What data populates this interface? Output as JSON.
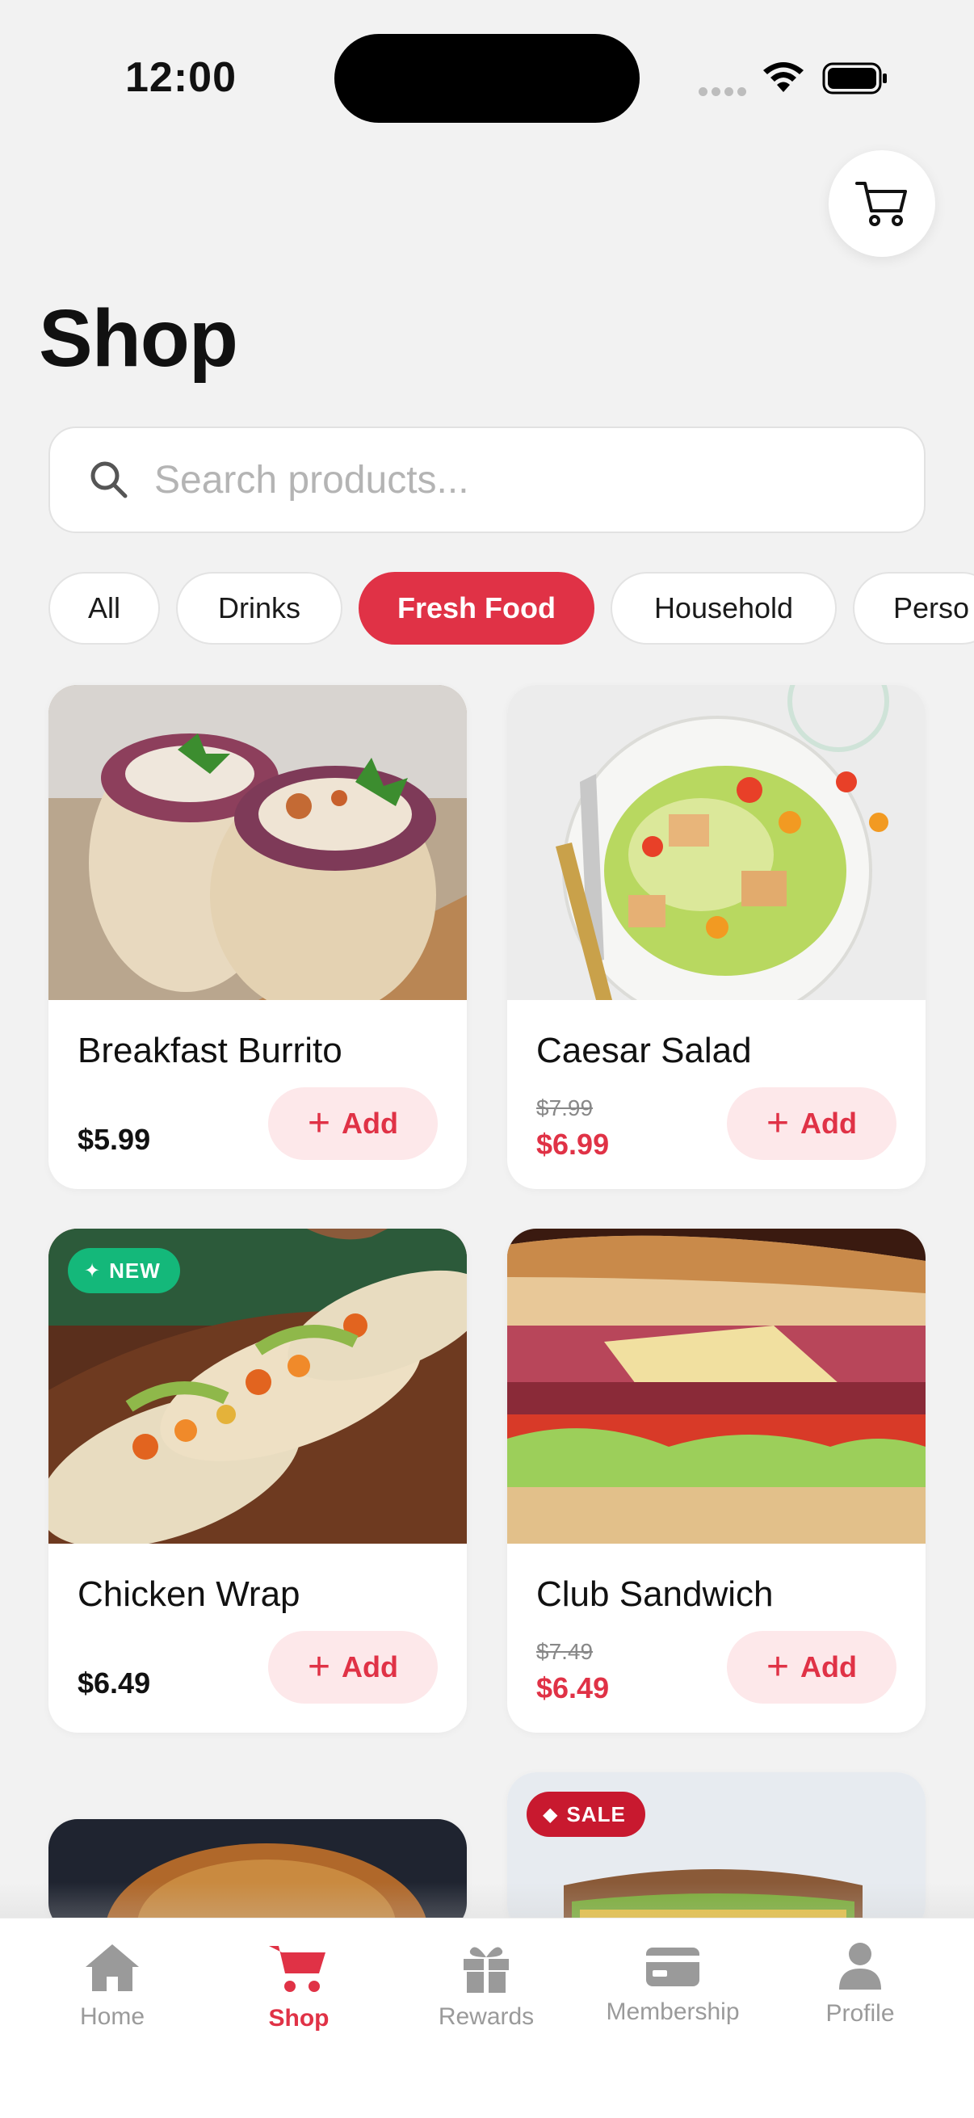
{
  "status": {
    "time": "12:00"
  },
  "header": {
    "title": "Shop"
  },
  "search": {
    "placeholder": "Search products..."
  },
  "categories": [
    "All",
    "Drinks",
    "Fresh Food",
    "Household",
    "Perso"
  ],
  "active_category": "Fresh Food",
  "products": [
    {
      "name": "Breakfast Burrito",
      "price": "$5.99",
      "add_label": "Add"
    },
    {
      "name": "Caesar Salad",
      "old_price": "$7.99",
      "price": "$6.99",
      "add_label": "Add"
    },
    {
      "name": "Chicken Wrap",
      "price": "$6.49",
      "badge": "NEW",
      "add_label": "Add"
    },
    {
      "name": "Club Sandwich",
      "old_price": "$7.49",
      "price": "$6.49",
      "add_label": "Add"
    }
  ],
  "partial_cards": [
    {
      "badge": "SALE"
    }
  ],
  "nav": {
    "items": [
      {
        "label": "Home",
        "icon": "home-icon"
      },
      {
        "label": "Shop",
        "icon": "cart-icon"
      },
      {
        "label": "Rewards",
        "icon": "gift-icon"
      },
      {
        "label": "Membership",
        "icon": "card-icon"
      },
      {
        "label": "Profile",
        "icon": "person-icon"
      }
    ],
    "active": "Shop"
  },
  "colors": {
    "accent": "#e03246",
    "accent_soft": "#fde8ea",
    "new_badge": "#14b87a",
    "sale_badge": "#c8192f"
  }
}
